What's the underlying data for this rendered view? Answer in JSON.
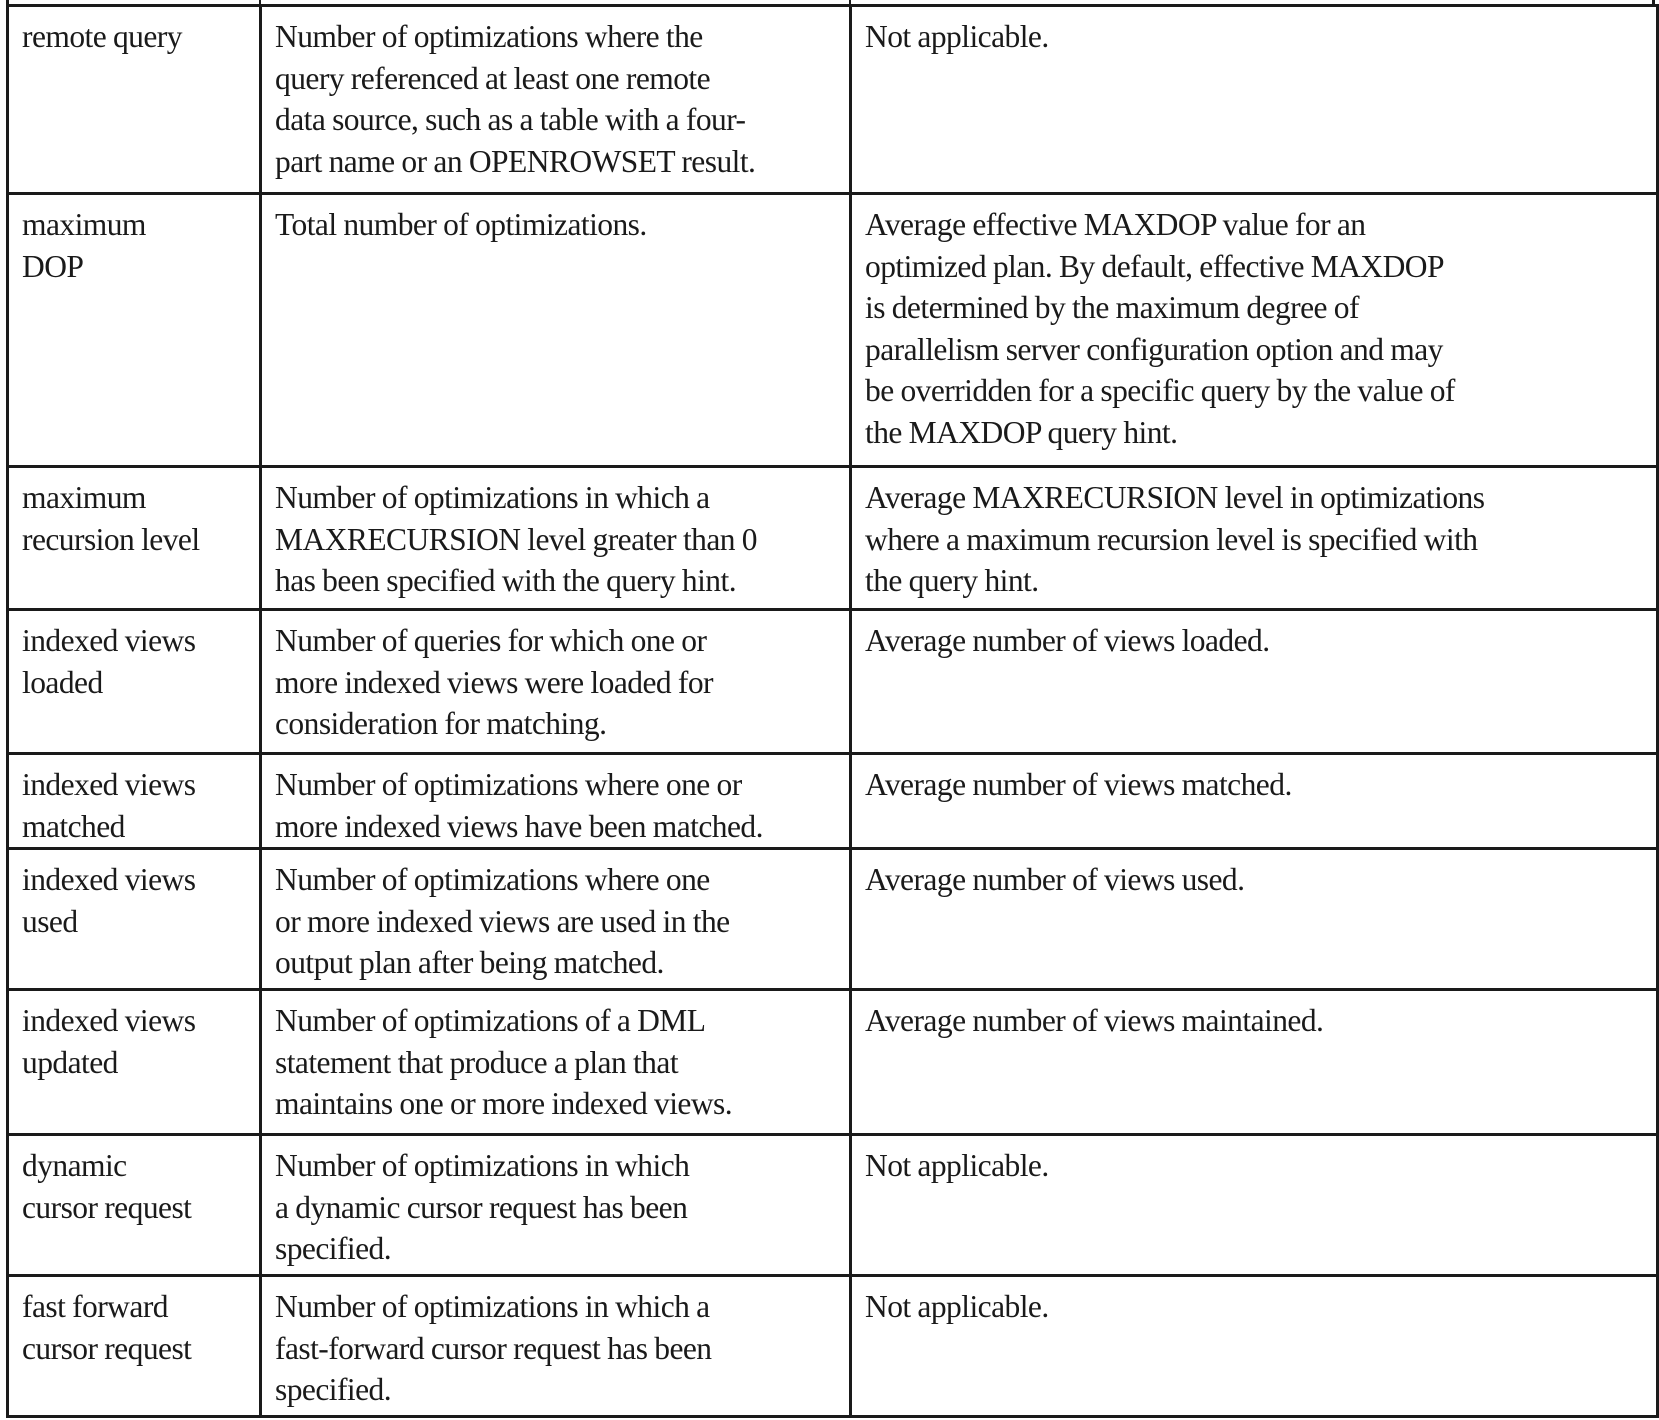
{
  "table": {
    "rows": [
      {
        "counter": [
          "remote query"
        ],
        "occurrence": [
          "Number of optimizations where the",
          "query referenced at least one remote",
          "data source, such as a table with a four-",
          "part name or an OPENROWSET result."
        ],
        "value": [
          "Not applicable."
        ]
      },
      {
        "counter": [
          "maximum",
          "DOP"
        ],
        "occurrence": [
          "Total number of optimizations."
        ],
        "value": [
          "Average effective MAXDOP value for an",
          "optimized plan. By default, effective MAXDOP",
          "is determined by the maximum degree of",
          "parallelism server configuration option and may",
          "be overridden for a specific query by the value of",
          "the MAXDOP query hint."
        ]
      },
      {
        "counter": [
          "maximum",
          "recursion level"
        ],
        "occurrence": [
          "Number of optimizations in which a",
          "MAXRECURSION level greater than 0",
          "has been specified with the query hint."
        ],
        "value": [
          "Average MAXRECURSION level in optimizations",
          "where a maximum recursion level is specified with",
          "the query hint."
        ]
      },
      {
        "counter": [
          "indexed views",
          "loaded"
        ],
        "occurrence": [
          "Number of queries for which one or",
          "more indexed views were loaded for",
          "consideration for matching."
        ],
        "value": [
          "Average number of views loaded."
        ]
      },
      {
        "counter": [
          "indexed views",
          "matched"
        ],
        "occurrence": [
          "Number of optimizations where one or",
          "more indexed views have been matched."
        ],
        "value": [
          "Average number of views matched."
        ]
      },
      {
        "counter": [
          "indexed views",
          "used"
        ],
        "occurrence": [
          "Number of optimizations where one",
          "or more indexed views are used in the",
          "output plan after being matched."
        ],
        "value": [
          "Average number of views used."
        ]
      },
      {
        "counter": [
          "indexed views",
          "updated"
        ],
        "occurrence": [
          "Number of optimizations of a DML",
          "statement that produce a plan that",
          "maintains one or more indexed views."
        ],
        "value": [
          "Average number of views maintained."
        ]
      },
      {
        "counter": [
          "dynamic",
          "cursor request"
        ],
        "occurrence": [
          "Number of optimizations in which",
          "a dynamic cursor request has been",
          "specified."
        ],
        "value": [
          "Not applicable."
        ]
      },
      {
        "counter": [
          "fast forward",
          "cursor request"
        ],
        "occurrence": [
          "Number of optimizations in which a",
          "fast-forward cursor request has been",
          "specified."
        ],
        "value": [
          "Not applicable."
        ]
      }
    ]
  }
}
